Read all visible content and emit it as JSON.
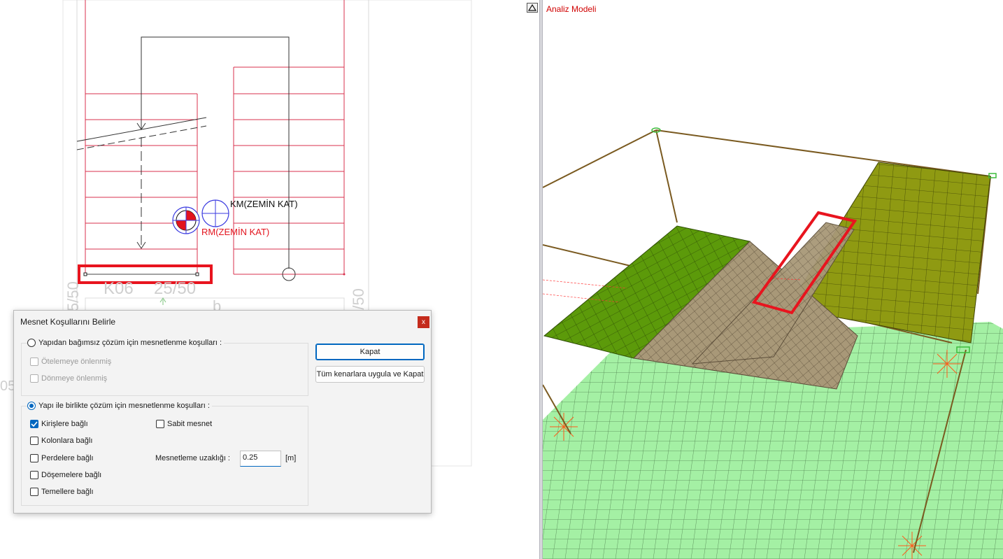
{
  "plan_view": {
    "labels": {
      "km_label": "KM(ZEMİN KAT)",
      "rm_label": "RM(ZEMİN KAT)",
      "beam_label": "K06",
      "beam_size": "25/50",
      "left_dim": "5/50",
      "right_dim": "5/50",
      "left_edge_text": "05"
    }
  },
  "analysis_view": {
    "title": "Analiz Modeli",
    "collapse_icon": "triangle-up-icon"
  },
  "dialog": {
    "title": "Mesnet Koşullarını Belirle",
    "close_label": "x",
    "group1": {
      "radio_label": "Yapıdan bağımsız çözüm için mesnetlenme koşulları :",
      "selected": false,
      "checks": [
        {
          "label": "Ötelemeye önlenmiş",
          "checked": false,
          "enabled": false
        },
        {
          "label": "Dönmeye önlenmiş",
          "checked": false,
          "enabled": false
        }
      ]
    },
    "group2": {
      "radio_label": "Yapı ile birlikte çözüm için mesnetlenme koşulları :",
      "selected": true,
      "checks_left": [
        {
          "label": "Kirişlere bağlı",
          "checked": true
        },
        {
          "label": "Kolonlara bağlı",
          "checked": false
        },
        {
          "label": "Perdelere bağlı",
          "checked": false
        },
        {
          "label": "Döşemelere bağlı",
          "checked": false
        },
        {
          "label": "Temellere bağlı",
          "checked": false
        }
      ],
      "sabit_mesnet": {
        "label": "Sabit mesnet",
        "checked": false
      },
      "distance_label": "Mesnetleme uzaklığı :",
      "distance_value": "0.25",
      "distance_unit": "[m]"
    },
    "buttons": {
      "close": "Kapat",
      "apply_all": "Tüm kenarlara uygula ve Kapat"
    }
  },
  "colors": {
    "plan_red": "#d8304c",
    "highlight_red": "#e8141e",
    "slab_green": "#5c9a0a",
    "slab_olive": "#8f9a12",
    "ground_green": "#a4f0a4",
    "stair_tan": "#a89878",
    "frame_brown": "#7a5a20",
    "accent_blue": "#0067c0"
  }
}
